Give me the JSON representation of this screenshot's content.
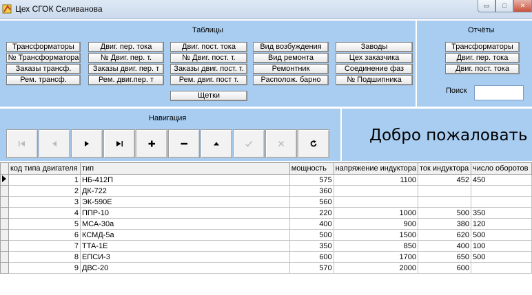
{
  "window": {
    "title": "Цех СГОК Селиванова",
    "minimize_glyph": "▭",
    "maximize_glyph": "□",
    "close_glyph": "✕"
  },
  "tables_panel": {
    "title": "Таблицы",
    "columns": [
      [
        "Трансформаторы",
        "№ Трансформатора",
        "Заказы трансф.",
        "Рем. трансф."
      ],
      [
        "Двиг. пер. тока",
        "№ Двиг. пер. т.",
        "Заказы двиг. пер. т",
        "Рем. двиг.пер. т"
      ],
      [
        "Двиг. пост. тока",
        "№ Двиг. пост. т.",
        "Заказы двиг. пост. т.",
        "Рем. двиг. пост т."
      ],
      [
        "Вид возбуждения",
        "Вид ремонта",
        "Ремонтник",
        "Располож. барно"
      ],
      [
        "Заводы",
        "Цех заказчика",
        "Соединение фаз",
        "№ Подшипника"
      ]
    ],
    "brushes_label": "Щетки"
  },
  "reports_panel": {
    "title": "Отчёты",
    "buttons": [
      "Трансформаторы",
      "Двиг. пер. тока",
      "Двиг. пост. тока"
    ],
    "search_label": "Поиск",
    "search_value": ""
  },
  "navigation_panel": {
    "title": "Навигация",
    "buttons": [
      {
        "icon": "first-record-icon",
        "enabled": false
      },
      {
        "icon": "previous-record-icon",
        "enabled": false
      },
      {
        "icon": "next-record-icon",
        "enabled": true
      },
      {
        "icon": "last-record-icon",
        "enabled": true
      },
      {
        "icon": "add-record-icon",
        "enabled": true
      },
      {
        "icon": "delete-record-icon",
        "enabled": true
      },
      {
        "icon": "edit-record-icon",
        "enabled": true
      },
      {
        "icon": "post-record-icon",
        "enabled": false
      },
      {
        "icon": "cancel-record-icon",
        "enabled": false
      },
      {
        "icon": "refresh-icon",
        "enabled": true
      }
    ]
  },
  "welcome": {
    "text": "Добро пожаловать"
  },
  "grid": {
    "columns": [
      "код типа двигателя",
      "тип",
      "мощность",
      "напряжение индуктора",
      "ток индуктора",
      "число оборотов"
    ],
    "rows": [
      [
        "1",
        "НБ-412П",
        "575",
        "1100",
        "452",
        "450"
      ],
      [
        "2",
        "ДК-722",
        "360",
        "",
        "",
        ""
      ],
      [
        "3",
        "ЭК-590Е",
        "560",
        "",
        "",
        ""
      ],
      [
        "4",
        "ППР-10",
        "220",
        "1000",
        "500",
        "350"
      ],
      [
        "5",
        "МСА-30а",
        "400",
        "900",
        "380",
        "120"
      ],
      [
        "6",
        "КСМД-5а",
        "500",
        "1500",
        "620",
        "500"
      ],
      [
        "7",
        "ТТА-1Е",
        "350",
        "850",
        "400",
        "100"
      ],
      [
        "8",
        "ЕПСИ-3",
        "600",
        "1700",
        "650",
        "500"
      ],
      [
        "9",
        "ДВС-20",
        "570",
        "2000",
        "600",
        ""
      ]
    ],
    "current_row": 0
  }
}
